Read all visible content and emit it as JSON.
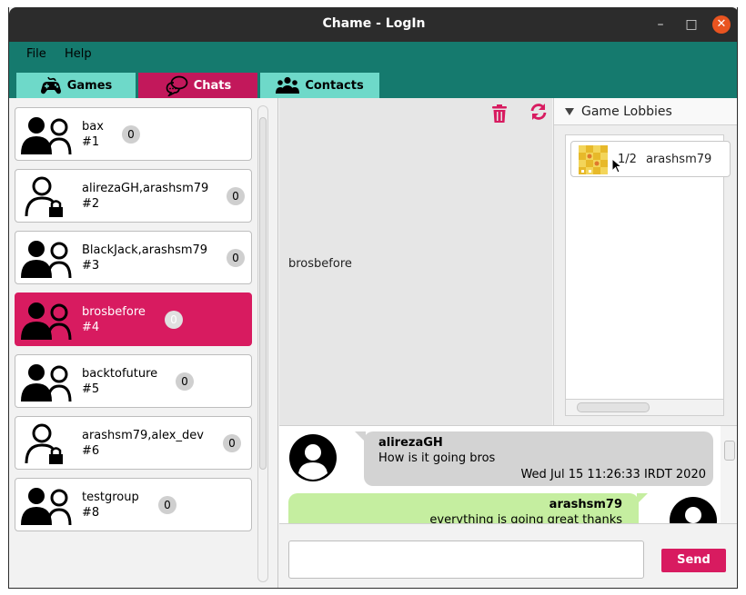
{
  "window": {
    "title": "Chame - LogIn"
  },
  "window_controls": {
    "minimize": "–",
    "maximize": "□",
    "close": "✕"
  },
  "menu": {
    "file": "File",
    "help": "Help"
  },
  "tabs": {
    "games": "Games",
    "chats": "Chats",
    "contacts": "Contacts"
  },
  "chats": [
    {
      "name": "bax",
      "number": "#1",
      "unread": "0",
      "type": "group-icon"
    },
    {
      "name": "alirezaGH,arashsm79",
      "number": "#2",
      "unread": "0",
      "type": "private-user-icon"
    },
    {
      "name": "BlackJack,arashsm79",
      "number": "#3",
      "unread": "0",
      "type": "group-icon"
    },
    {
      "name": "brosbefore",
      "number": "#4",
      "unread": "0",
      "type": "group-icon",
      "selected": true
    },
    {
      "name": "backtofuture",
      "number": "#5",
      "unread": "0",
      "type": "group-icon"
    },
    {
      "name": "arashsm79,alex_dev",
      "number": "#6",
      "unread": "0",
      "type": "private-user-icon"
    },
    {
      "name": "testgroup",
      "number": "#8",
      "unread": "0",
      "type": "group-icon"
    }
  ],
  "chat_info": {
    "group_name": "brosbefore"
  },
  "lobbies": {
    "title": "Game Lobbies",
    "items": [
      {
        "players": "1/2",
        "owner": "arashsm79"
      }
    ]
  },
  "messages": [
    {
      "sender": "alirezaGH",
      "text": "How is it going bros",
      "time": "Wed Jul 15 11:26:33 IRDT 2020"
    },
    {
      "sender": "arashsm79",
      "text": "everything is going great thanks"
    }
  ],
  "composer": {
    "placeholder": "",
    "send_label": "Send"
  },
  "colors": {
    "accent": "#d81b60",
    "teal": "#157a6e",
    "tab_inactive": "#6ed9c9",
    "incoming_bubble": "#d3d3d3",
    "outgoing_bubble": "#c5eea0"
  }
}
